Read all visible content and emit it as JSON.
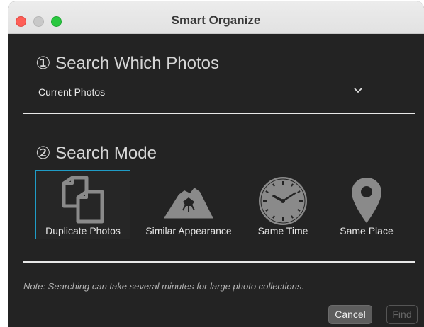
{
  "window": {
    "title": "Smart Organize"
  },
  "search_which": {
    "title": "① Search Which Photos",
    "selected_value": "Current Photos"
  },
  "search_mode": {
    "title": "② Search Mode",
    "modes": [
      {
        "label": "Duplicate Photos",
        "icon": "duplicate-photos-icon",
        "selected": true
      },
      {
        "label": "Similar Appearance",
        "icon": "mountain-icon",
        "selected": false
      },
      {
        "label": "Same Time",
        "icon": "clock-icon",
        "selected": false
      },
      {
        "label": "Same Place",
        "icon": "map-pin-icon",
        "selected": false
      }
    ]
  },
  "note": "Note: Searching can take several minutes for large photo collections.",
  "buttons": {
    "cancel": "Cancel",
    "find": "Find"
  },
  "colors": {
    "accent": "#1f9cc6",
    "background": "#232323",
    "icon": "#8a8a8a"
  }
}
